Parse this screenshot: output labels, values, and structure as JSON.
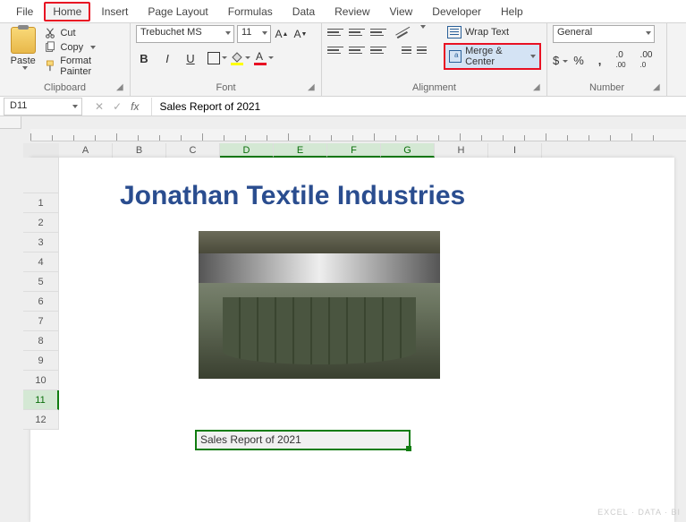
{
  "tabs": [
    "File",
    "Home",
    "Insert",
    "Page Layout",
    "Formulas",
    "Data",
    "Review",
    "View",
    "Developer",
    "Help"
  ],
  "active_tab_index": 1,
  "clipboard": {
    "paste": "Paste",
    "cut": "Cut",
    "copy": "Copy",
    "format_painter": "Format Painter",
    "group": "Clipboard"
  },
  "font": {
    "name": "Trebuchet MS",
    "size": "11",
    "group": "Font",
    "bold": "B",
    "italic": "I",
    "underline": "U"
  },
  "alignment": {
    "wrap": "Wrap Text",
    "merge": "Merge & Center",
    "group": "Alignment"
  },
  "number": {
    "format": "General",
    "group": "Number",
    "currency": "$",
    "percent": "%",
    "comma": ","
  },
  "name_box": "D11",
  "formula": "Sales Report of 2021",
  "columns": [
    "A",
    "B",
    "C",
    "D",
    "E",
    "F",
    "G",
    "H",
    "I"
  ],
  "selected_cols": [
    "D",
    "E",
    "F",
    "G"
  ],
  "rows": [
    "1",
    "2",
    "3",
    "4",
    "5",
    "6",
    "7",
    "8",
    "9",
    "10",
    "11",
    "12"
  ],
  "selected_row": "11",
  "content": {
    "title": "Jonathan Textile Industries",
    "cell_text": "Sales Report of 2021"
  },
  "watermark": "EXCEL · DATA · BI"
}
